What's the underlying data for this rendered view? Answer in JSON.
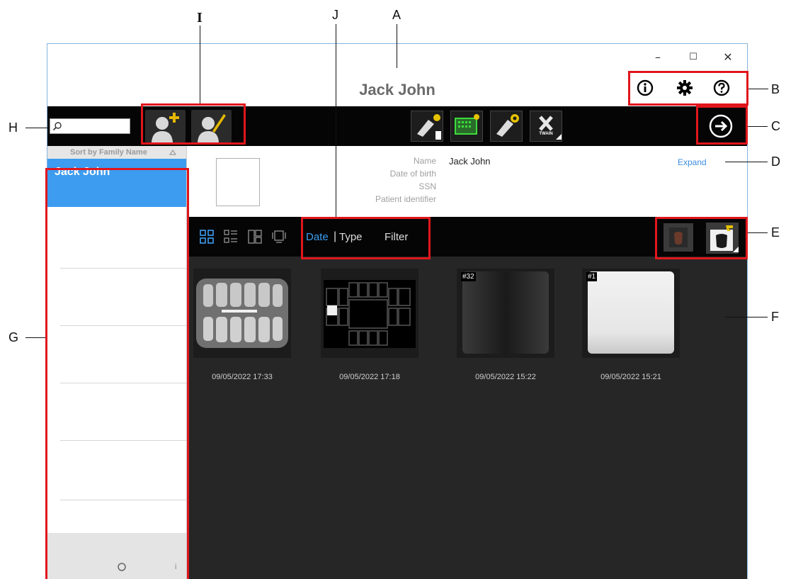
{
  "window": {
    "title": "Jack John",
    "controls": {
      "minimize": "–",
      "maximize": "☐",
      "close": "✕"
    }
  },
  "header_icons": [
    "info-icon",
    "gear-icon",
    "help-icon"
  ],
  "toolbar": {
    "search_placeholder": "",
    "patient_buttons": [
      "add-patient-icon",
      "edit-patient-icon"
    ],
    "acquisition_buttons": [
      "xray-acquisition-icon",
      "sensor-acquisition-icon",
      "intraoral-camera-icon",
      "twain-icon"
    ],
    "twain_label": "TWAIN",
    "next_icon": "arrow-right-icon"
  },
  "patient_list": {
    "sort_label": "Sort by Family Name",
    "selected_patient": "Jack John",
    "footer_count": "i"
  },
  "patient_info": {
    "labels": {
      "name": "Name",
      "dob": "Date of birth",
      "ssn": "SSN",
      "identifier": "Patient identifier"
    },
    "values": {
      "name": "Jack John",
      "dob": "",
      "ssn": "",
      "identifier": ""
    },
    "expand_label": "Expand"
  },
  "view_bar": {
    "view_modes": [
      "grid-view-icon",
      "list-view-icon",
      "compare-view-icon",
      "slide-view-icon"
    ],
    "sort_date": "Date",
    "sort_separator": "|",
    "sort_type": "Type",
    "filter": "Filter"
  },
  "images": [
    {
      "date": "09/05/2022 17:33",
      "tag": ""
    },
    {
      "date": "09/05/2022 17:18",
      "tag": ""
    },
    {
      "date": "09/05/2022 15:22",
      "tag": "#32"
    },
    {
      "date": "09/05/2022 15:21",
      "tag": "#1"
    }
  ],
  "annotations": {
    "A": "A",
    "B": "B",
    "C": "C",
    "D": "D",
    "E": "E",
    "F": "F",
    "G": "G",
    "H": "H",
    "I": "I",
    "J": "J"
  },
  "colors": {
    "accent": "#3d9cf0",
    "toolbar": "#050505",
    "content": "#262626",
    "annotation_box": "#e0161c"
  }
}
